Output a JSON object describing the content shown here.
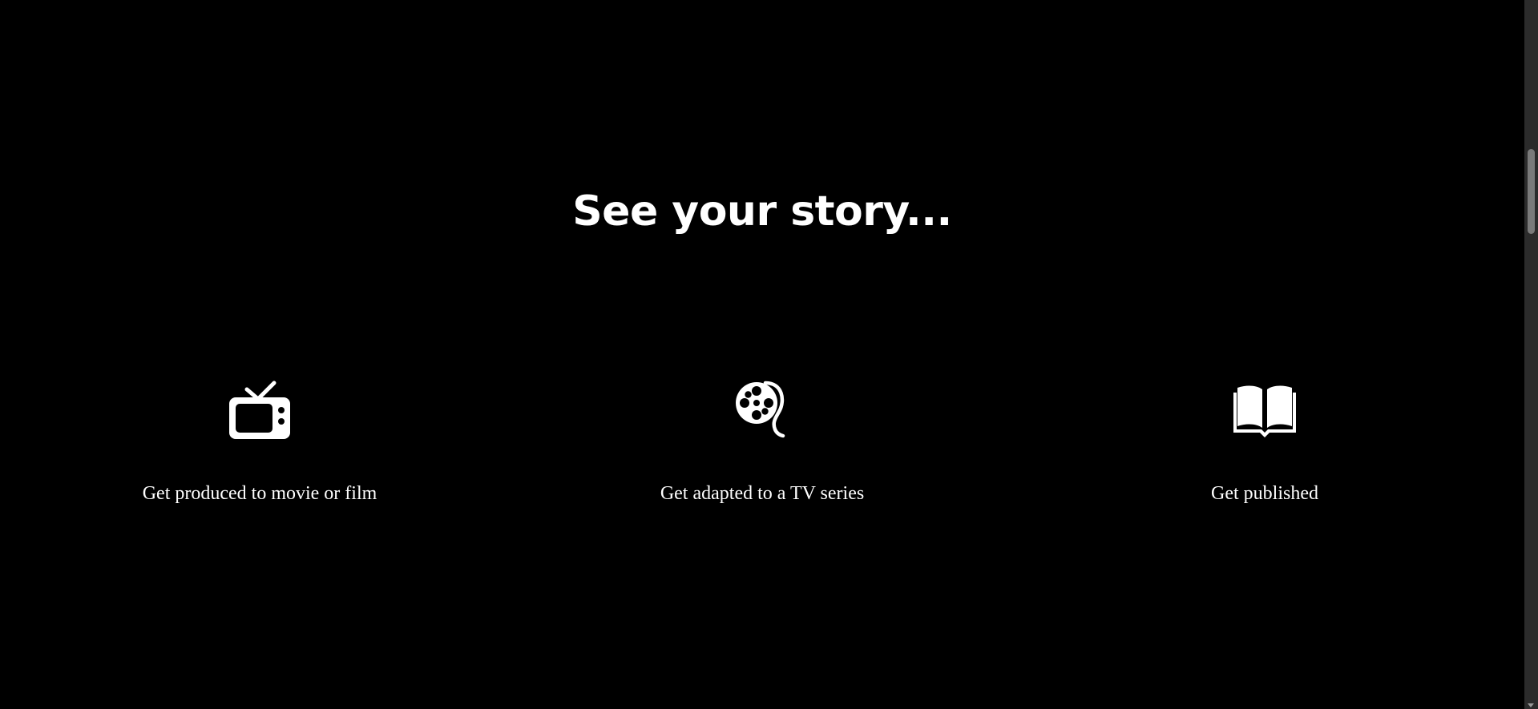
{
  "section": {
    "headline": "See your story..."
  },
  "features": [
    {
      "icon": "tv-icon",
      "label": "Get produced to movie or film"
    },
    {
      "icon": "film-reel-icon",
      "label": "Get adapted to a TV series"
    },
    {
      "icon": "open-book-icon",
      "label": "Get published"
    }
  ],
  "colors": {
    "background": "#000000",
    "text": "#ffffff",
    "scrollbar_track": "#2b2b2b",
    "scrollbar_thumb": "#7a7a7a"
  }
}
